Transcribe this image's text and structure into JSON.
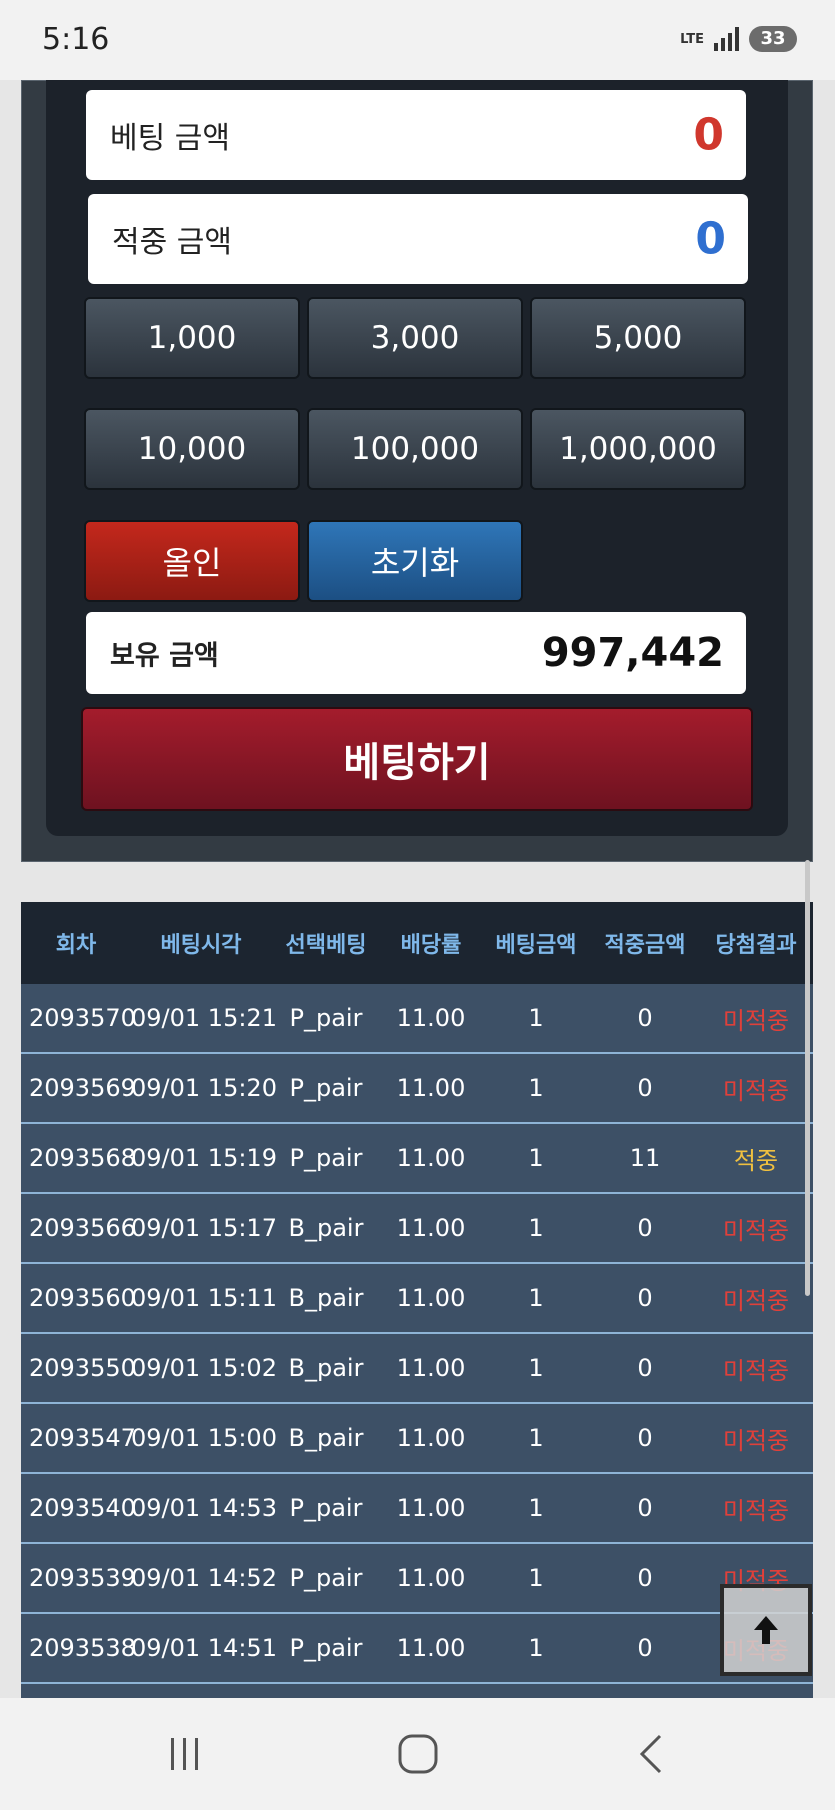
{
  "status_bar": {
    "time": "5:16",
    "network": "LTE",
    "battery": "33"
  },
  "bet_panel": {
    "bet_amount": {
      "label": "베팅 금액",
      "value": "0",
      "color": "#d0372d"
    },
    "win_amount": {
      "label": "적중 금액",
      "value": "0",
      "color": "#2f6fd0"
    },
    "chips": [
      "1,000",
      "3,000",
      "5,000",
      "10,000",
      "100,000",
      "1,000,000"
    ],
    "allin_label": "올인",
    "reset_label": "초기화",
    "balance": {
      "label": "보유 금액",
      "value": "997,442"
    },
    "bet_button_label": "베팅하기"
  },
  "history": {
    "columns": [
      "회차",
      "베팅시각",
      "선택베팅",
      "배당률",
      "베팅금액",
      "적중금액",
      "당첨결과"
    ],
    "rows": [
      [
        "2093570",
        "09/01 15:21",
        "P_pair",
        "11.00",
        "1",
        "0",
        "미적중"
      ],
      [
        "2093569",
        "09/01 15:20",
        "P_pair",
        "11.00",
        "1",
        "0",
        "미적중"
      ],
      [
        "2093568",
        "09/01 15:19",
        "P_pair",
        "11.00",
        "1",
        "11",
        "적중"
      ],
      [
        "2093566",
        "09/01 15:17",
        "B_pair",
        "11.00",
        "1",
        "0",
        "미적중"
      ],
      [
        "2093560",
        "09/01 15:11",
        "B_pair",
        "11.00",
        "1",
        "0",
        "미적중"
      ],
      [
        "2093550",
        "09/01 15:02",
        "B_pair",
        "11.00",
        "1",
        "0",
        "미적중"
      ],
      [
        "2093547",
        "09/01 15:00",
        "B_pair",
        "11.00",
        "1",
        "0",
        "미적중"
      ],
      [
        "2093540",
        "09/01 14:53",
        "P_pair",
        "11.00",
        "1",
        "0",
        "미적중"
      ],
      [
        "2093539",
        "09/01 14:52",
        "P_pair",
        "11.00",
        "1",
        "0",
        "미적중"
      ],
      [
        "2093538",
        "09/01 14:51",
        "P_pair",
        "11.00",
        "1",
        "0",
        "미적중"
      ]
    ],
    "miss_color": "#e0403a",
    "hit_color": "#f0c040"
  },
  "icons": {
    "scroll_top": "arrow-up-icon",
    "nav_recent": "recent-apps-icon",
    "nav_home": "home-icon",
    "nav_back": "back-icon"
  }
}
